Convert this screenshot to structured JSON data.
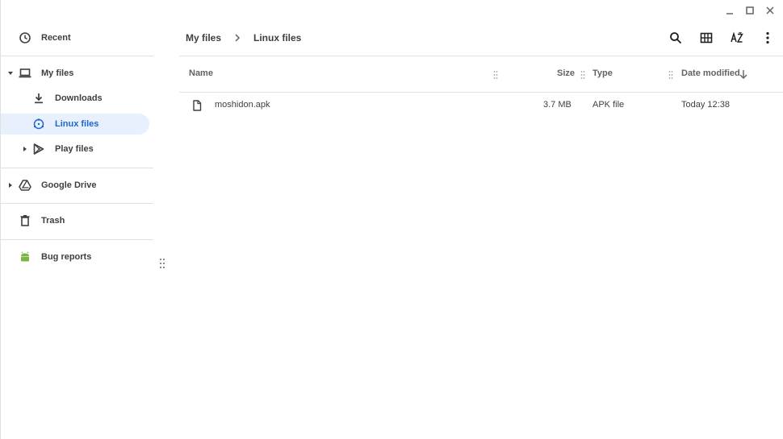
{
  "sidebar": {
    "items": [
      {
        "label": "Recent",
        "icon": "clock-icon"
      },
      {
        "label": "My files",
        "icon": "laptop-icon"
      },
      {
        "label": "Downloads",
        "icon": "download-icon"
      },
      {
        "label": "Linux files",
        "icon": "linux-icon"
      },
      {
        "label": "Play files",
        "icon": "play-icon"
      },
      {
        "label": "Google Drive",
        "icon": "drive-icon"
      },
      {
        "label": "Trash",
        "icon": "trash-icon"
      },
      {
        "label": "Bug reports",
        "icon": "android-icon"
      }
    ],
    "active": "Linux files"
  },
  "breadcrumb": {
    "parent": "My files",
    "current": "Linux files"
  },
  "table": {
    "columns": {
      "name": "Name",
      "size": "Size",
      "type": "Type",
      "date": "Date modified"
    },
    "rows": [
      {
        "name": "moshidon.apk",
        "size": "3.7 MB",
        "type": "APK file",
        "date": "Today 12:38"
      }
    ]
  },
  "colors": {
    "active_bg": "#e8f0fe",
    "active_text": "#1967d2",
    "android_green": "#7cb342"
  }
}
